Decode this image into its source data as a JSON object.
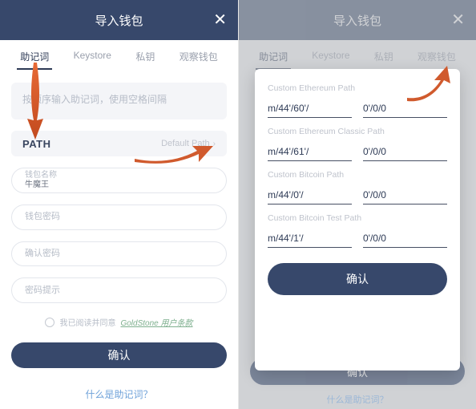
{
  "header": {
    "title": "导入钱包",
    "close_glyph": "✕"
  },
  "tabs": {
    "items": [
      {
        "label": "助记词",
        "active": true
      },
      {
        "label": "Keystore",
        "active": false
      },
      {
        "label": "私钥",
        "active": false
      },
      {
        "label": "观察钱包",
        "active": false
      }
    ]
  },
  "form": {
    "mnemonic_placeholder": "按顺序输入助记词，使用空格间隔",
    "path_label": "PATH",
    "path_value": "Default Path",
    "fields": {
      "name_label": "钱包名称",
      "name_value": "牛魔王",
      "pw_label": "钱包密码",
      "confirm_pw_label": "确认密码",
      "hint_label": "密码提示"
    },
    "terms_prefix": "我已阅读并同意",
    "terms_link": "GoldStone 用户条款",
    "confirm_label": "确认",
    "help_label": "什么是助记词？"
  },
  "sheet": {
    "groups": [
      {
        "title": "Custom Ethereum Path",
        "prefix": "m/44'/60'/",
        "suffix": "0'/0/0"
      },
      {
        "title": "Custom Ethereum Classic Path",
        "prefix": "m/44'/61'/",
        "suffix": "0'/0/0"
      },
      {
        "title": "Custom Bitcoin Path",
        "prefix": "m/44'/0'/",
        "suffix": "0'/0/0"
      },
      {
        "title": "Custom Bitcoin Test Path",
        "prefix": "m/44'/1'/",
        "suffix": "0'/0/0"
      }
    ],
    "confirm_label": "确认"
  }
}
